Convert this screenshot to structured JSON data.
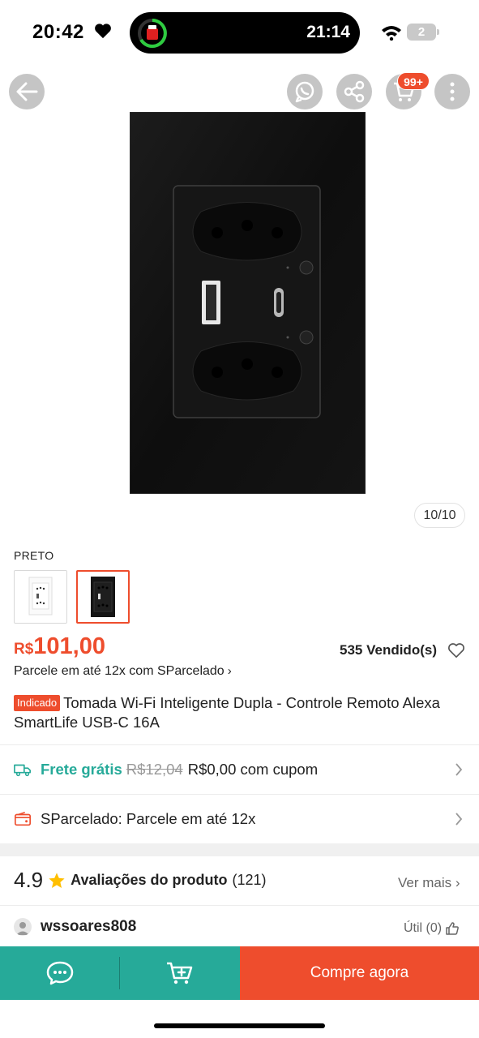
{
  "status_bar": {
    "time": "20:42",
    "island_time": "21:14",
    "battery": "2"
  },
  "header": {
    "cart_badge": "99+"
  },
  "gallery": {
    "page_indicator": "10/10"
  },
  "variation": {
    "label": "PRETO",
    "options": [
      "white",
      "black"
    ],
    "selected": "black"
  },
  "price": {
    "currency": "R$",
    "amount": "101,00",
    "sold": "535 Vendido(s)",
    "installment": "Parcele em até 12x com SParcelado",
    "installment_chevron": "›"
  },
  "product": {
    "badge": "Indicado",
    "title": "Tomada Wi-Fi Inteligente Dupla - Controle Remoto Alexa SmartLife USB-C 16A"
  },
  "shipping": {
    "label": "Frete grátis",
    "old_price": "R$12,04",
    "coupon_text": "R$0,00 com cupom"
  },
  "sparcelado": {
    "text": "SParcelado: Parcele em até 12x"
  },
  "ratings": {
    "score": "4.9",
    "title": "Avaliações do produto",
    "count": "(121)",
    "see_more": "Ver mais",
    "see_more_chevron": "›"
  },
  "review": {
    "username": "wssoares808",
    "helpful": "Útil (0)"
  },
  "bottom_bar": {
    "buy_label": "Compre agora"
  },
  "colors": {
    "brand_orange": "#ee4d2d",
    "teal": "#26aa99"
  }
}
